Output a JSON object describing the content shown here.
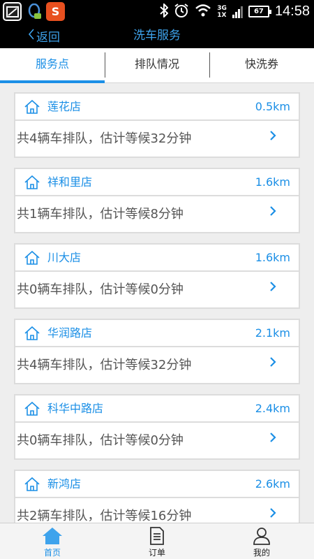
{
  "status_bar": {
    "time": "14:58",
    "battery": "67",
    "network_top": "3G",
    "network_bottom": "1X",
    "apps": [
      "notification-app-icon",
      "qq-app-icon",
      "sogou-app-icon"
    ],
    "sogou_letter": "S"
  },
  "nav": {
    "back_label": "返回",
    "title": "洗车服务"
  },
  "tabs": [
    {
      "label": "服务点",
      "active": true
    },
    {
      "label": "排队情况",
      "active": false
    },
    {
      "label": "快洗券",
      "active": false
    }
  ],
  "stores": [
    {
      "name": "莲花店",
      "distance": "0.5km",
      "queue": "共4辆车排队，估计等候32分钟"
    },
    {
      "name": "祥和里店",
      "distance": "1.6km",
      "queue": "共1辆车排队，估计等候8分钟"
    },
    {
      "name": "川大店",
      "distance": "1.6km",
      "queue": "共0辆车排队，估计等候0分钟"
    },
    {
      "name": "华润路店",
      "distance": "2.1km",
      "queue": "共4辆车排队，估计等候32分钟"
    },
    {
      "name": "科华中路店",
      "distance": "2.4km",
      "queue": "共0辆车排队，估计等候0分钟"
    },
    {
      "name": "新鸿店",
      "distance": "2.6km",
      "queue": "共2辆车排队，估计等候16分钟"
    }
  ],
  "bottom_nav": [
    {
      "label": "首页",
      "icon": "home-icon",
      "active": true
    },
    {
      "label": "订单",
      "icon": "document-icon",
      "active": false
    },
    {
      "label": "我的",
      "icon": "person-icon",
      "active": false
    }
  ],
  "colors": {
    "accent": "#1b8fe6",
    "nav_text": "#3ea3ec",
    "background": "#eeeeee"
  }
}
